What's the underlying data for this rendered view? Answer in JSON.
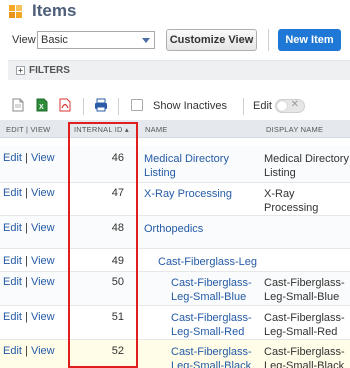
{
  "page": {
    "title": "Items"
  },
  "controls": {
    "view_label": "View",
    "view_value": "Basic",
    "customize_label": "Customize View",
    "new_label": "New Item"
  },
  "filters": {
    "toggle": "+",
    "label": "FILTERS"
  },
  "toolbar": {
    "show_inactives_label": "Show Inactives",
    "edit_label": "Edit"
  },
  "table": {
    "headers": {
      "edit_view": "EDIT | VIEW",
      "internal_id": "INTERNAL ID ▴",
      "name": "NAME",
      "display_name": "DISPLAY NAME"
    },
    "edit_text": "Edit",
    "sep_text": "|",
    "view_text": "View",
    "rows": [
      {
        "id": "46",
        "name": "Medical Directory Listing",
        "display": "Medical Directory Listing"
      },
      {
        "id": "47",
        "name": "X-Ray Processing",
        "display": "X-Ray Processing"
      },
      {
        "id": "48",
        "name": "Orthopedics",
        "display": ""
      },
      {
        "id": "49",
        "name": "Cast-Fiberglass-Leg",
        "display": ""
      },
      {
        "id": "50",
        "name": "Cast-Fiberglass-Leg-Small-Blue",
        "display": "Cast-Fiberglass-Leg-Small-Blue"
      },
      {
        "id": "51",
        "name": "Cast-Fiberglass-Leg-Small-Red",
        "display": "Cast-Fiberglass-Leg-Small-Red"
      },
      {
        "id": "52",
        "name": "Cast-Fiberglass-Leg-Small-Black",
        "display": "Cast-Fiberglass-Leg-Small-Black"
      }
    ]
  },
  "colors": {
    "link": "#255ba6",
    "primary_button": "#1f78d5",
    "highlight_box": "#e01e1e"
  }
}
